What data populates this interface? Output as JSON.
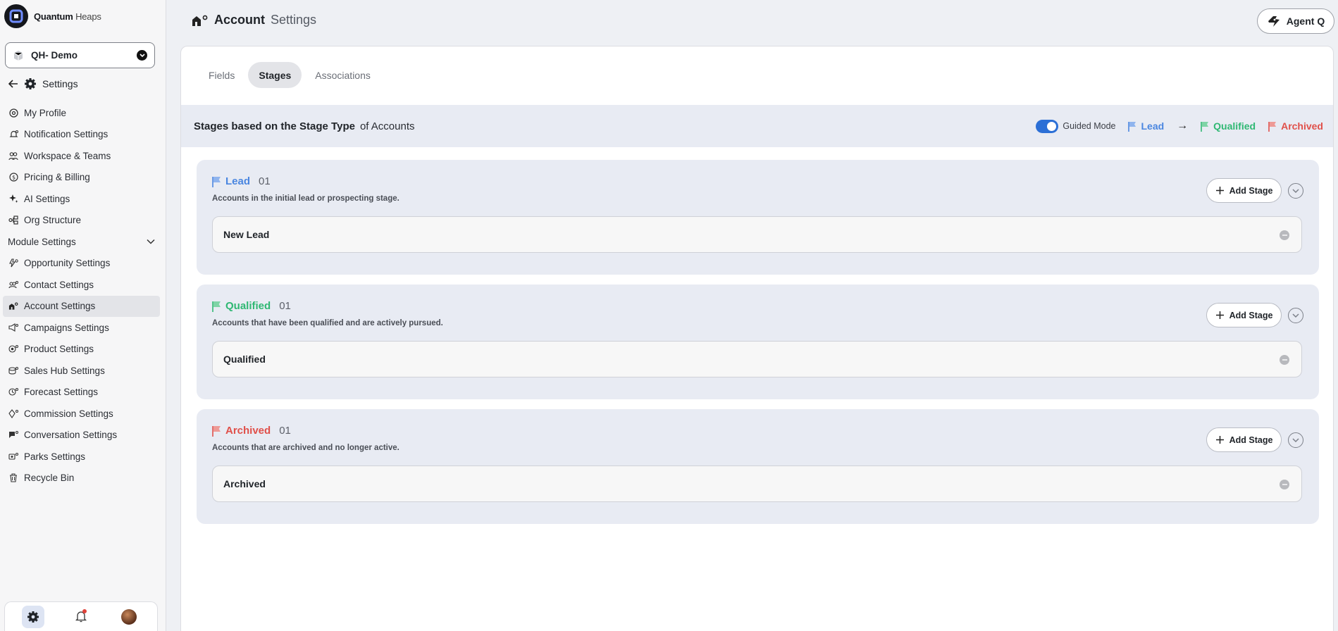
{
  "brand": {
    "name_bold": "Quantum",
    "name_rest": " Heaps"
  },
  "workspace": {
    "label": "QH- Demo"
  },
  "settings_header": {
    "title": "Settings"
  },
  "sidebar": {
    "items": [
      {
        "label": "My Profile",
        "icon": "at-sign-icon"
      },
      {
        "label": "Notification Settings",
        "icon": "bell-icon"
      },
      {
        "label": "Workspace & Teams",
        "icon": "users-icon"
      },
      {
        "label": "Pricing & Billing",
        "icon": "dollar-icon"
      },
      {
        "label": "AI Settings",
        "icon": "sparkle-icon"
      },
      {
        "label": "Org Structure",
        "icon": "org-icon"
      }
    ],
    "module_section": "Module Settings",
    "module_items": [
      {
        "label": "Opportunity Settings",
        "icon": "opportunity-icon"
      },
      {
        "label": "Contact Settings",
        "icon": "contact-icon"
      },
      {
        "label": "Account Settings",
        "icon": "account-icon",
        "active": true
      },
      {
        "label": "Campaigns Settings",
        "icon": "campaign-icon"
      },
      {
        "label": "Product Settings",
        "icon": "product-icon"
      },
      {
        "label": "Sales Hub Settings",
        "icon": "sales-hub-icon"
      },
      {
        "label": "Forecast Settings",
        "icon": "forecast-icon"
      },
      {
        "label": "Commission Settings",
        "icon": "commission-icon"
      },
      {
        "label": "Conversation Settings",
        "icon": "conversation-icon"
      },
      {
        "label": "Parks Settings",
        "icon": "parks-icon"
      },
      {
        "label": "Recycle Bin",
        "icon": "trash-icon"
      }
    ]
  },
  "header": {
    "title_bold": "Account",
    "title_rest": "Settings",
    "agent_button": "Agent Q"
  },
  "tabs": [
    "Fields",
    "Stages",
    "Associations"
  ],
  "active_tab": "Stages",
  "stage_type_bar": {
    "label": "Stages based on the Stage Type",
    "suffix": "of Accounts",
    "guided_mode": "Guided Mode",
    "guided_mode_on": true,
    "flow": [
      "Lead",
      "Qualified",
      "Archived"
    ],
    "arrow": "→"
  },
  "colors": {
    "lead": "#4a86e0",
    "qualified": "#2fb873",
    "archived": "#e0504a",
    "accent": "#2b6fd6"
  },
  "stages": [
    {
      "name": "Lead",
      "count": "01",
      "description": "Accounts in the initial lead or prospecting stage.",
      "add_label": "Add Stage",
      "rows": [
        "New Lead"
      ]
    },
    {
      "name": "Qualified",
      "count": "01",
      "description": "Accounts that have been qualified and are actively pursued.",
      "add_label": "Add Stage",
      "rows": [
        "Qualified"
      ]
    },
    {
      "name": "Archived",
      "count": "01",
      "description": "Accounts that are archived and no longer active.",
      "add_label": "Add Stage",
      "rows": [
        "Archived"
      ]
    }
  ]
}
